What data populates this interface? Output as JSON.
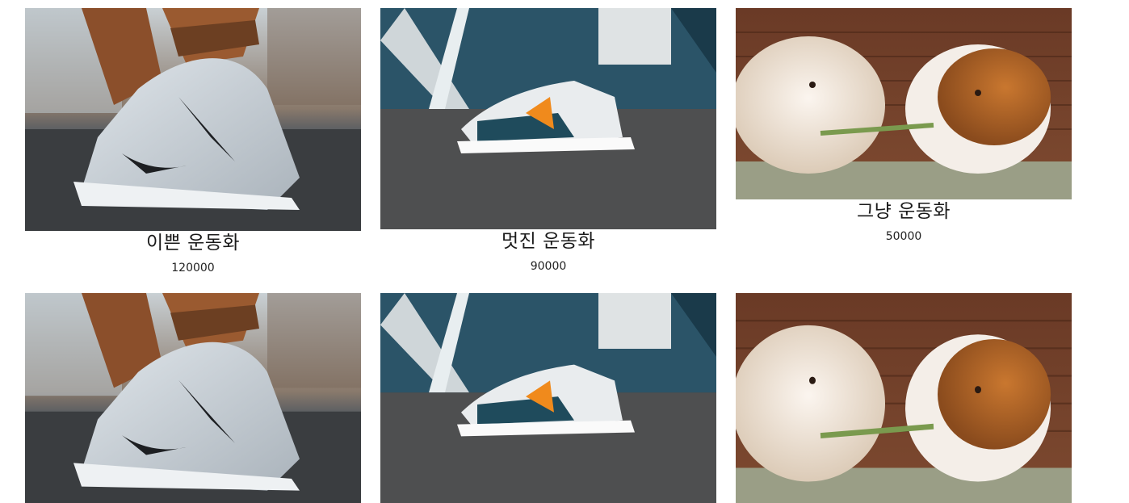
{
  "products": [
    {
      "name": "이쁜 운동화",
      "price": "120000",
      "image": "nike-sneaker-photo"
    },
    {
      "name": "멋진 운동화",
      "price": "90000",
      "image": "kswiss-sneaker-photo"
    },
    {
      "name": "그냥 운동화",
      "price": "50000",
      "image": "guinea-pigs-photo"
    },
    {
      "image": "nike-sneaker-photo"
    },
    {
      "image": "kswiss-sneaker-photo"
    },
    {
      "image": "guinea-pigs-photo"
    }
  ]
}
